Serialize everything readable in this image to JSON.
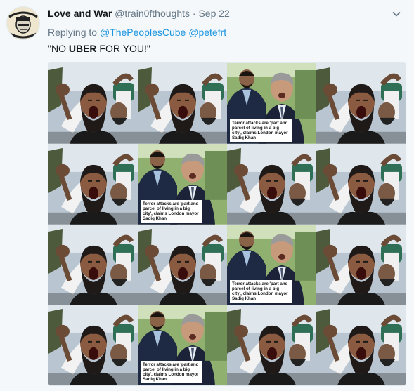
{
  "tweet": {
    "author_name": "Love and War",
    "author_handle": "@train0fthoughts",
    "separator": "·",
    "date": "Sep 22",
    "replying_prefix": "Replying to",
    "reply_targets": [
      "@ThePeoplesCube",
      "@petefrt"
    ],
    "text_before": "\"NO ",
    "text_bold": "UBER",
    "text_after": " FOR YOU!\""
  },
  "media": {
    "caption": "Terror attacks are 'part and parcel of living in a big city', claims London mayor Sadiq Khan",
    "grid": [
      [
        "shouting-man",
        "shouting-man",
        "mayor",
        "shouting-man"
      ],
      [
        "shouting-man",
        "mayor",
        "shouting-man",
        "shouting-man"
      ],
      [
        "shouting-man",
        "shouting-man",
        "mayor",
        "shouting-man"
      ],
      [
        "shouting-man",
        "mayor",
        "shouting-man",
        "shouting-man"
      ]
    ]
  },
  "icons": {
    "avatar": "avatar-icon",
    "caret": "chevron-down-icon"
  },
  "colors": {
    "background": "#f5f8fa",
    "link": "#1b95e0",
    "muted": "#657786"
  }
}
